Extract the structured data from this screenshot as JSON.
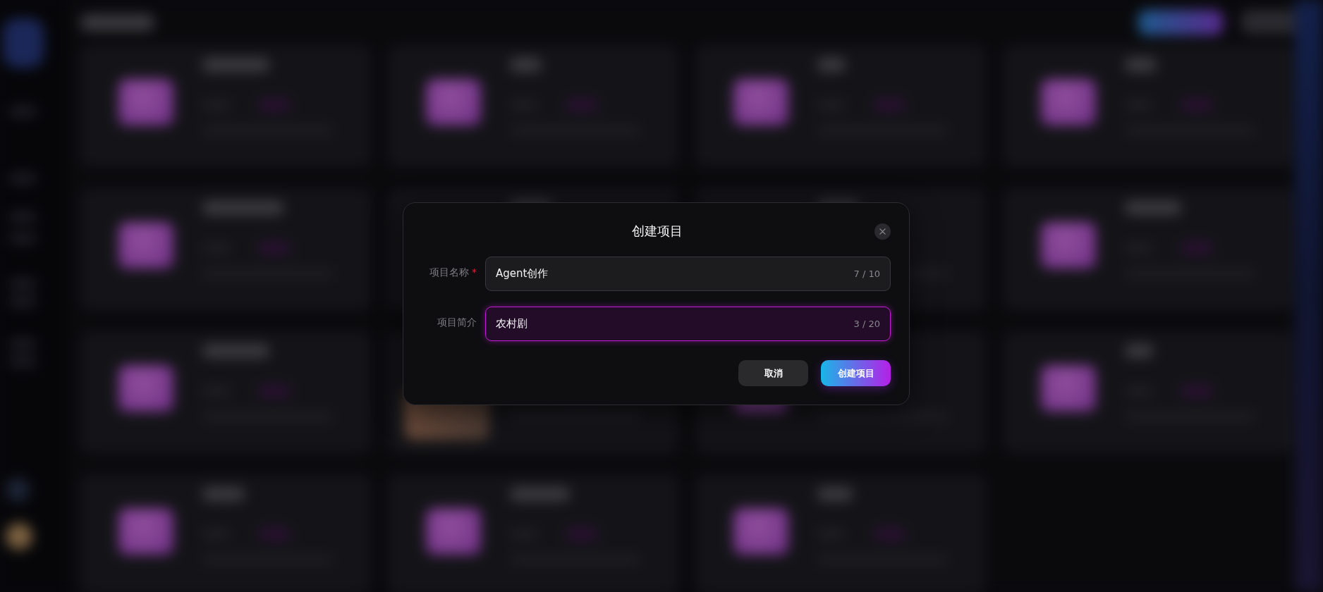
{
  "dialog": {
    "title": "创建项目",
    "fields": [
      {
        "label": "项目名称",
        "required_mark": "*",
        "value": "Agent创作",
        "counter": "7 / 10",
        "focused": false
      },
      {
        "label": "项目简介",
        "value": "农村剧",
        "counter": "3 / 20",
        "focused": true
      }
    ],
    "buttons": [
      {
        "label": "取消",
        "kind": "secondary"
      },
      {
        "label": "创建项目",
        "kind": "primary"
      }
    ]
  }
}
